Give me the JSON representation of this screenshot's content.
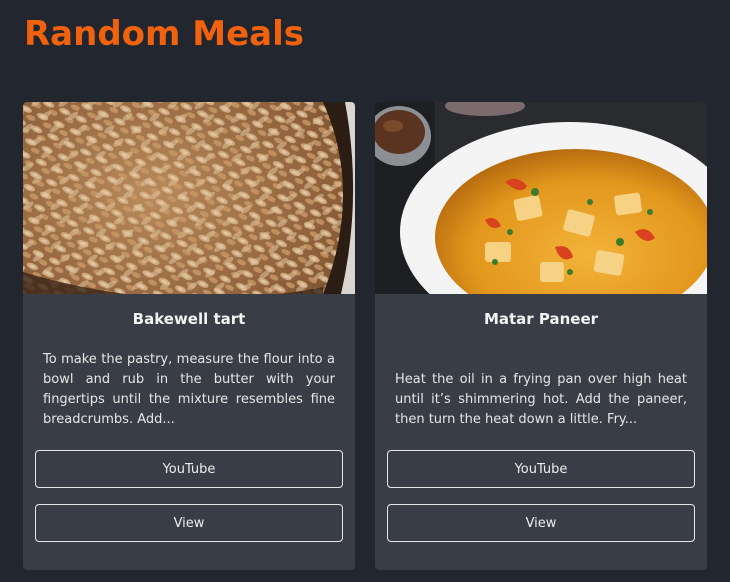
{
  "header": {
    "title": "Random Meals"
  },
  "meals": [
    {
      "name": "Bakewell tart",
      "description": "To make the pastry, measure the flour into a bowl and rub in the butter with your fingertips until the mixture resembles fine breadcrumbs. Add...",
      "youtube_label": "YouTube",
      "view_label": "View"
    },
    {
      "name": "Matar Paneer",
      "description": "Heat the oil in a frying pan over high heat until it’s shimmering hot. Add the paneer, then turn the heat down a little. Fry...",
      "youtube_label": "YouTube",
      "view_label": "View"
    }
  ]
}
